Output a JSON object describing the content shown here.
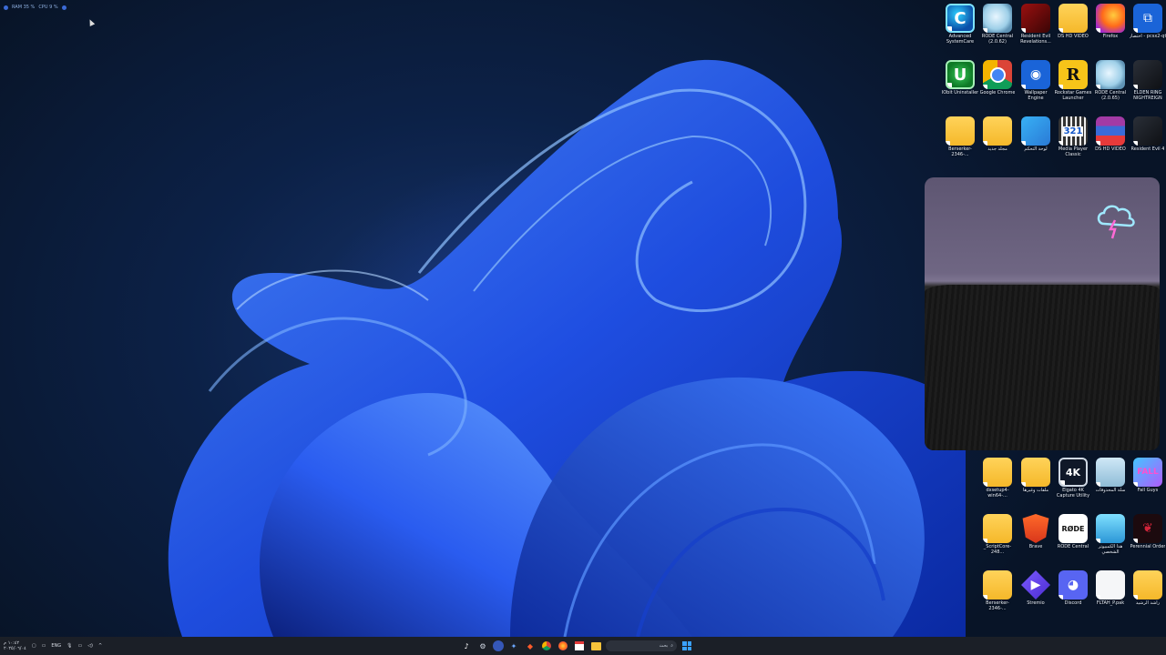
{
  "perf_overlay": {
    "ram": "RAM 35 %",
    "cpu": "CPU 9 %"
  },
  "desktop_icons": [
    {
      "id": "advanced-systemcare",
      "label": "Advanced SystemCare",
      "icon": "systemcare-icon",
      "glyph": "C",
      "style": "circ-c"
    },
    {
      "id": "rode-central-2062",
      "label": "RODE Central (2.0.62)",
      "icon": "disk-icon",
      "glyph": "",
      "style": "disk"
    },
    {
      "id": "resident-evil-revelations",
      "label": "Resident Evil Revelations...",
      "icon": "game-icon",
      "glyph": "",
      "style": "red-game"
    },
    {
      "id": "ds-hd-video-folder",
      "label": "DS HD VIDEO",
      "icon": "folder-icon",
      "glyph": "",
      "style": "folder"
    },
    {
      "id": "firefox",
      "label": "Firefox",
      "icon": "firefox-icon",
      "glyph": "",
      "style": "firefox"
    },
    {
      "id": "pcsx2",
      "label": "اختصار - pcsx2-qt",
      "icon": "pcsx2-icon",
      "glyph": "⧉",
      "style": "wallpaper-eng"
    },
    {
      "id": "iobit-uninstaller",
      "label": "IObit Uninstaller",
      "icon": "uninstaller-icon",
      "glyph": "U",
      "style": "circ-u"
    },
    {
      "id": "google-chrome",
      "label": "Google Chrome",
      "icon": "chrome-icon",
      "glyph": "",
      "style": "chrome"
    },
    {
      "id": "wallpaper-engine",
      "label": "Wallpaper Engine",
      "icon": "wallpaper-engine-icon",
      "glyph": "◉",
      "style": "wallpaper-eng"
    },
    {
      "id": "rockstar-launcher",
      "label": "Rockstar Games Launcher",
      "icon": "rockstar-icon",
      "glyph": "R",
      "style": "rockstar"
    },
    {
      "id": "rode-central-2065",
      "label": "RODE Central (2.0.65)",
      "icon": "disk-icon",
      "glyph": "",
      "style": "disk"
    },
    {
      "id": "elden-ring-nightreign",
      "label": "ELDEN RING NIGHTREIGN",
      "icon": "game-icon",
      "glyph": "",
      "style": "dark-game"
    },
    {
      "id": "berserker-folder-1",
      "label": "Berserker-2346-...",
      "icon": "folder-icon",
      "glyph": "",
      "style": "folder"
    },
    {
      "id": "new-folder",
      "label": "مجلد جديد",
      "icon": "folder-icon",
      "glyph": "",
      "style": "folder"
    },
    {
      "id": "control-panel",
      "label": "لوحة التحكم",
      "icon": "control-panel-icon",
      "glyph": "",
      "style": "cpanel"
    },
    {
      "id": "media-player-classic",
      "label": "Media Player Classic",
      "icon": "media-player-icon",
      "glyph": "321",
      "style": "mpc"
    },
    {
      "id": "ds-hd-video-rar",
      "label": "DS HD VIDEO",
      "icon": "winrar-icon",
      "glyph": "",
      "style": "winrar"
    },
    {
      "id": "resident-evil-4",
      "label": "Resident Evil 4",
      "icon": "game-icon",
      "glyph": "",
      "style": "dark-game"
    },
    {
      "id": "dxsetup-folder",
      "label": "dxsetup4-win64-...",
      "icon": "folder-icon",
      "glyph": "",
      "style": "folder"
    },
    {
      "id": "files-folder",
      "label": "ملفات وغيرها",
      "icon": "folder-icon",
      "glyph": "",
      "style": "folder"
    },
    {
      "id": "elgato-4k",
      "label": "Elgato 4K Capture Utility",
      "icon": "elgato-icon",
      "glyph": "4K",
      "style": "k4"
    },
    {
      "id": "recycle-bin",
      "label": "سلة المحذوفات",
      "icon": "recycle-bin-icon",
      "glyph": "",
      "style": "recycle"
    },
    {
      "id": "fall-guys",
      "label": "Fall Guys",
      "icon": "fall-guys-icon",
      "glyph": "FALL",
      "style": "fallguys"
    },
    {
      "id": "scriptcore-folder",
      "label": "_ScriptCore-248...",
      "icon": "folder-icon",
      "glyph": "",
      "style": "folder"
    },
    {
      "id": "brave",
      "label": "Brave",
      "icon": "brave-icon",
      "glyph": "",
      "style": "brave"
    },
    {
      "id": "rode-central",
      "label": "RODE Central",
      "icon": "rode-icon",
      "glyph": "RØDE",
      "style": "rode"
    },
    {
      "id": "this-pc",
      "label": "هذا الكمبيوتر الشخصي",
      "icon": "monitor-icon",
      "glyph": "",
      "style": "monitor"
    },
    {
      "id": "perennial-order",
      "label": "Perennial Order",
      "icon": "perennial-icon",
      "glyph": "❦",
      "style": "perennial"
    },
    {
      "id": "berserker-folder-2",
      "label": "Berserker-2346-...",
      "icon": "folder-icon",
      "glyph": "",
      "style": "folder"
    },
    {
      "id": "stremio",
      "label": "Stremio",
      "icon": "stremio-icon",
      "glyph": "▶",
      "style": "stremio"
    },
    {
      "id": "discord",
      "label": "Discord",
      "icon": "discord-icon",
      "glyph": "◕",
      "style": "discord"
    },
    {
      "id": "fltah-pak",
      "label": "FLTAH_P.pak",
      "icon": "file-icon",
      "glyph": "",
      "style": "paper"
    },
    {
      "id": "user-folder",
      "label": "راشد الرشيد",
      "icon": "user-folder-icon",
      "glyph": "",
      "style": "person-folder"
    }
  ],
  "taskbar": {
    "time": "١٠:٤٢ م",
    "date": "٢٠٢٥/٠٦/٠٤",
    "language": "ENG",
    "search_placeholder": "بحث",
    "pinned": [
      "tiktok-icon",
      "settings-icon",
      "teamspeak-icon",
      "copilot-icon",
      "brave-icon",
      "chrome-icon",
      "firefox-icon",
      "calendar-icon",
      "files-icon"
    ]
  }
}
